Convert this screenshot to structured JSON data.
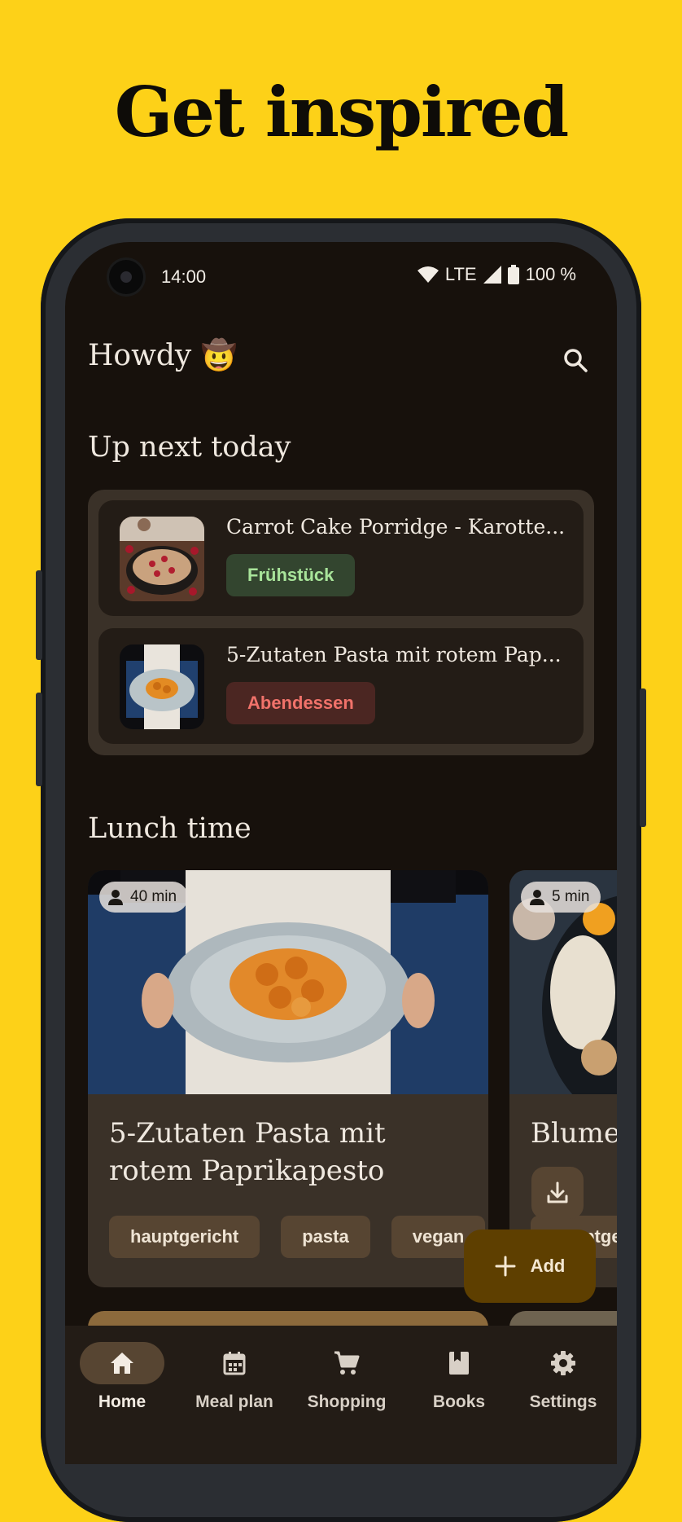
{
  "headline": "Get inspired",
  "status": {
    "time": "14:00",
    "network": "LTE",
    "battery": "100 %"
  },
  "header": {
    "greeting": "Howdy 🤠"
  },
  "up_next": {
    "title": "Up next today",
    "items": [
      {
        "title": "Carrot Cake Porridge - Karotte...",
        "tag": "Frühstück"
      },
      {
        "title": "5-Zutaten Pasta mit rotem Pap...",
        "tag": "Abendessen"
      }
    ]
  },
  "lunch": {
    "title": "Lunch time",
    "recipes": [
      {
        "time": "40 min",
        "title": "5-Zutaten Pasta mit rotem Paprikapesto",
        "tags": [
          "hauptgericht",
          "pasta",
          "vegan"
        ]
      },
      {
        "time": "5 min",
        "title": "Blume Kokos-",
        "tags": [
          "hauptge"
        ]
      }
    ]
  },
  "fab": {
    "add_label": "Add"
  },
  "nav": [
    {
      "label": "Home",
      "icon": "home-icon",
      "active": true
    },
    {
      "label": "Meal plan",
      "icon": "calendar-icon"
    },
    {
      "label": "Shopping",
      "icon": "cart-icon"
    },
    {
      "label": "Books",
      "icon": "book-icon"
    },
    {
      "label": "Settings",
      "icon": "gear-icon"
    }
  ],
  "colors": {
    "background": "#FDD118",
    "screen": "#17110c",
    "surface": "#3a3128",
    "accent": "#5e3f00"
  }
}
